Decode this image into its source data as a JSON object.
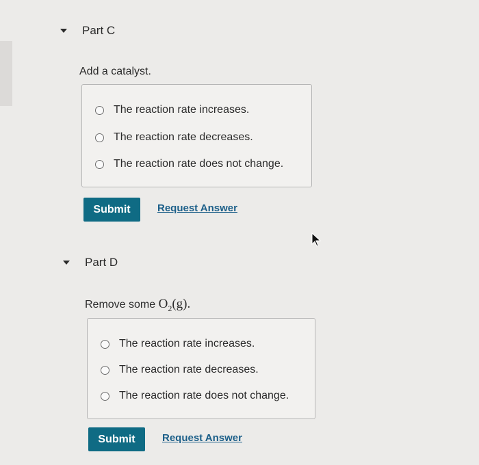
{
  "part_c": {
    "title": "Part C",
    "question": "Add a catalyst.",
    "choices": [
      "The reaction rate increases.",
      "The reaction rate decreases.",
      "The reaction rate does not change."
    ],
    "submit_label": "Submit",
    "request_label": "Request Answer"
  },
  "part_d": {
    "title": "Part D",
    "question_prefix": "Remove some ",
    "formula_main": "O",
    "formula_sub": "2",
    "formula_state": "(g)",
    "question_suffix": ".",
    "choices": [
      "The reaction rate increases.",
      "The reaction rate decreases.",
      "The reaction rate does not change."
    ],
    "submit_label": "Submit",
    "request_label": "Request Answer"
  },
  "colors": {
    "submit_bg": "#0f6b84",
    "link": "#1c5f89"
  }
}
